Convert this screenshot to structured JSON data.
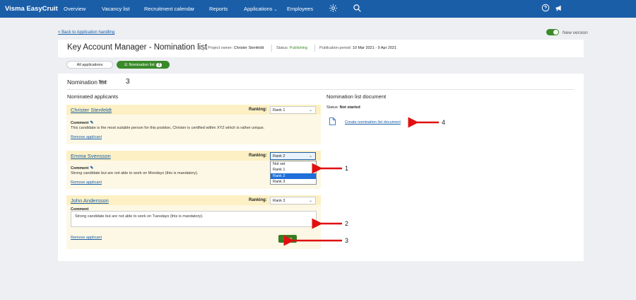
{
  "topbar": {
    "brand": "Visma EasyCruit",
    "nav": [
      "Overview",
      "Vacancy list",
      "Recruitment calendar",
      "Reports",
      "Applications",
      "Employees"
    ],
    "applications_chevron": "⌄",
    "icons": [
      "gear-icon",
      "search-icon",
      "help-icon",
      "announcement-icon"
    ],
    "bg_color": "#1a5ea8"
  },
  "toggle_label": "New version",
  "back_link": "< Back to Application handling",
  "header": {
    "title": "Key Account Manager - Nomination list",
    "project_owner_label": "Project owner:",
    "project_owner": "Christer Stenfeldt",
    "status_label": "Status:",
    "status": "Publishing",
    "period_label": "Publication period:",
    "period": "10 Mar 2021 - 9 Apr 2021"
  },
  "tabs": {
    "all": "All applications",
    "nomination": "Nomination list",
    "nomination_count": "3"
  },
  "nomination": {
    "title": "Nomination list",
    "total_label": "Total:",
    "total": "3",
    "applicants_heading": "Nominated applicants",
    "document_heading": "Nomination list document",
    "ranking_label": "Ranking:",
    "comment_label": "Comment",
    "remove_label": "Remove applicant",
    "save_label": "Save",
    "applicants": [
      {
        "name": "Christer Stenfeldt",
        "rank": "Rank 1",
        "comment": "This candidate is the most suitable person for this position, Christer is certified within XYZ which is rather unique."
      },
      {
        "name": "Emma Svensson",
        "rank": "Rank 2",
        "comment": "Strong candidate but are not able to work on Mondays (this is mandatory)."
      },
      {
        "name": "John Andersson",
        "rank": "Rank 3",
        "comment": "Strong candidate but are not able to work on Tuesdays (this is mandatory)."
      }
    ],
    "rank_options": [
      "Not set",
      "Rank 1",
      "Rank 2",
      "Rank 3"
    ],
    "selected_option": "Rank 2"
  },
  "document": {
    "status_label": "Status:",
    "status": "Not started",
    "create_link": "Create nomination list document"
  },
  "annotations": [
    "1",
    "2",
    "3",
    "4"
  ],
  "colors": {
    "accent_green": "#3a8a2a",
    "arrow_red": "#e01010",
    "link_blue": "#1a5ea8"
  }
}
